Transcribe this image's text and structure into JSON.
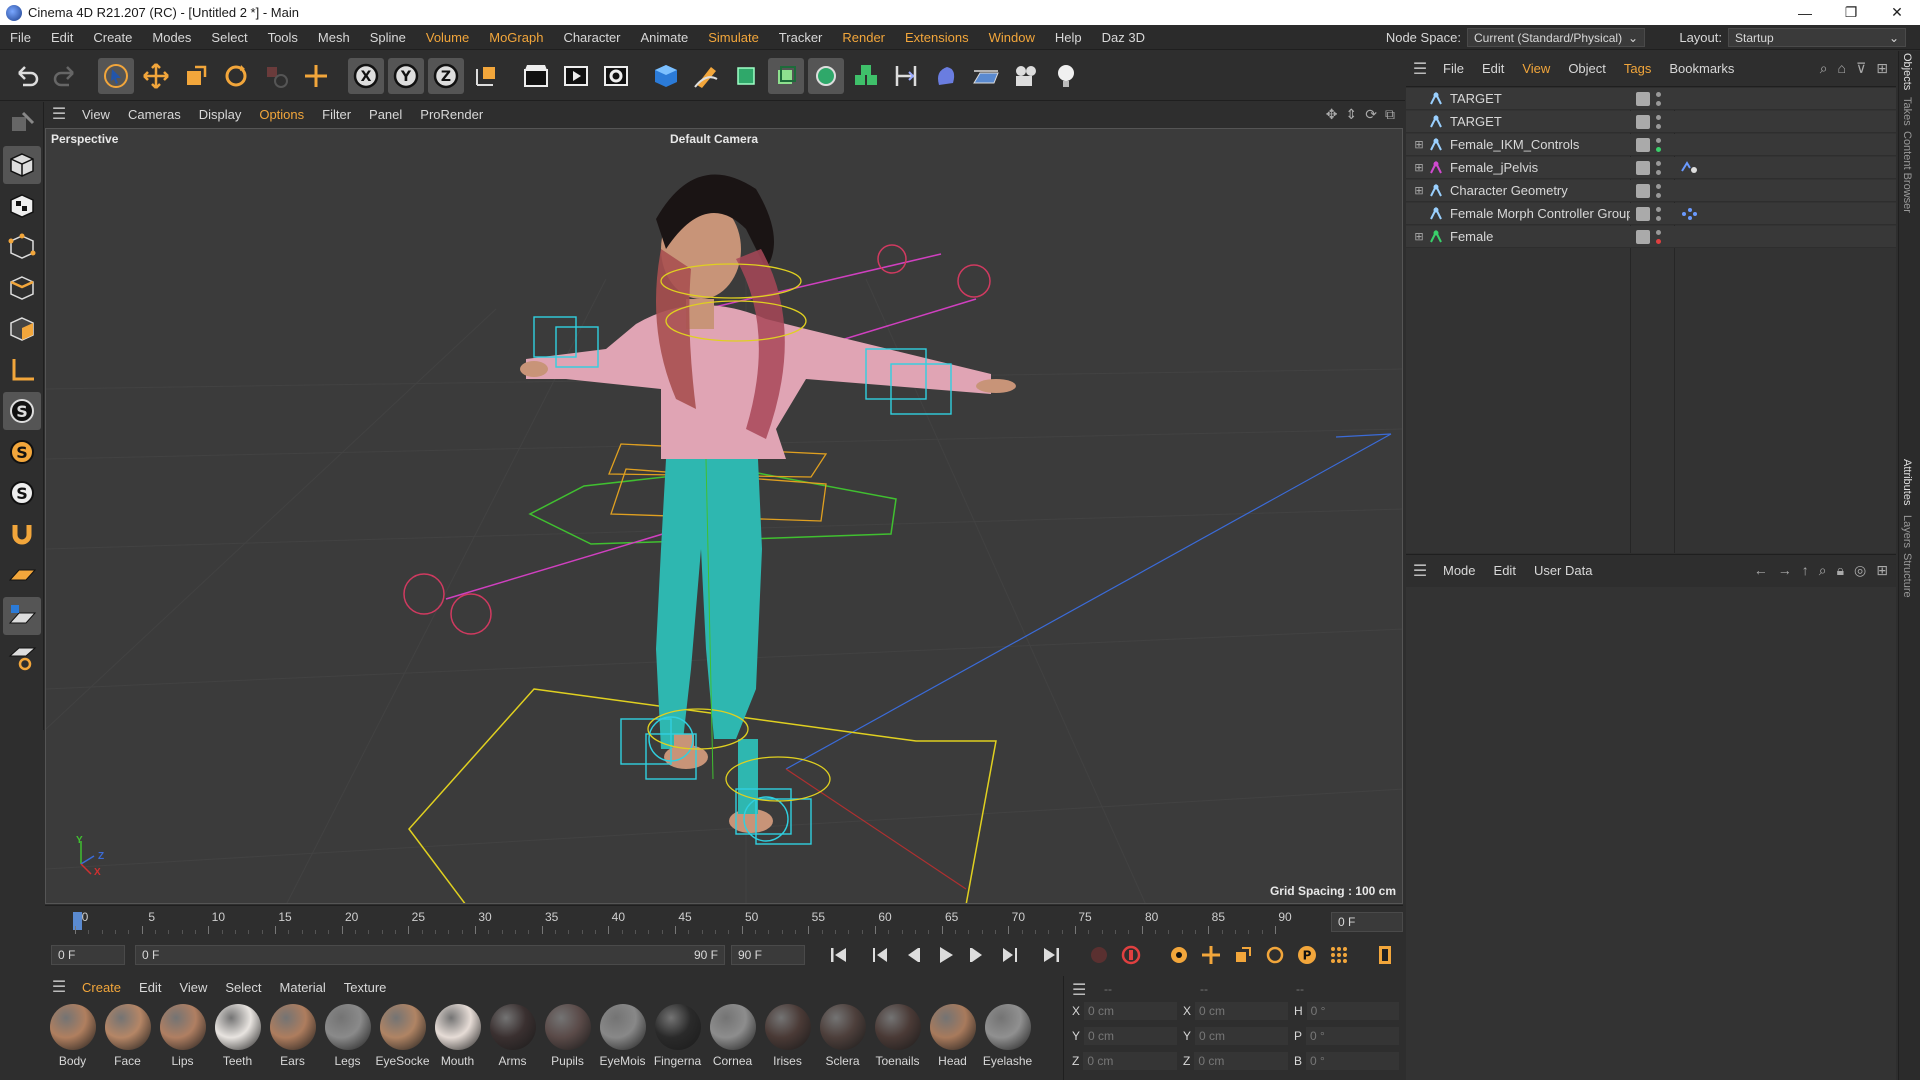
{
  "window": {
    "title": "Cinema 4D R21.207 (RC) - [Untitled 2 *] - Main",
    "minimize": "—",
    "maximize": "❐",
    "close": "✕"
  },
  "menubar": {
    "items": [
      "File",
      "Edit",
      "Create",
      "Modes",
      "Select",
      "Tools",
      "Mesh",
      "Spline",
      "Volume",
      "MoGraph",
      "Character",
      "Animate",
      "Simulate",
      "Tracker",
      "Render",
      "Extensions",
      "Window",
      "Help",
      "Daz 3D"
    ],
    "node_space_label": "Node Space:",
    "node_space_value": "Current (Standard/Physical)",
    "layout_label": "Layout:",
    "layout_value": "Startup"
  },
  "viewport": {
    "menu": [
      "View",
      "Cameras",
      "Display",
      "Options",
      "Filter",
      "Panel",
      "ProRender"
    ],
    "view_name": "Perspective",
    "camera_name": "Default Camera",
    "grid_spacing": "Grid Spacing : 100 cm",
    "axis_labels": {
      "y": "Y",
      "z": "Z",
      "x": "X"
    }
  },
  "timeline": {
    "ticks": [
      "0",
      "5",
      "10",
      "15",
      "20",
      "25",
      "30",
      "35",
      "40",
      "45",
      "50",
      "55",
      "60",
      "65",
      "70",
      "75",
      "80",
      "85",
      "90"
    ],
    "current_frame": "0 F",
    "start_field": "0 F",
    "range_start": "0 F",
    "range_end": "90 F",
    "end_field": "90 F"
  },
  "material_manager": {
    "menu": [
      "Create",
      "Edit",
      "View",
      "Select",
      "Material",
      "Texture"
    ],
    "materials": [
      {
        "name": "Body",
        "color": "#b07f5f"
      },
      {
        "name": "Face",
        "color": "#b58666"
      },
      {
        "name": "Lips",
        "color": "#b07f62"
      },
      {
        "name": "Teeth",
        "color": "#e8e4e0"
      },
      {
        "name": "Ears",
        "color": "#ae7d5e"
      },
      {
        "name": "Legs",
        "color": "#8a8a8a"
      },
      {
        "name": "EyeSocke",
        "color": "#b08464"
      },
      {
        "name": "Mouth",
        "color": "#e6dcd6"
      },
      {
        "name": "Arms",
        "color": "#3a3030"
      },
      {
        "name": "Pupils",
        "color": "#5a4a48"
      },
      {
        "name": "EyeMois",
        "color": "#888888"
      },
      {
        "name": "Fingerna",
        "color": "#2a2a2a"
      },
      {
        "name": "Cornea",
        "color": "#8d8d8d"
      },
      {
        "name": "Irises",
        "color": "#4a3a36"
      },
      {
        "name": "Sclera",
        "color": "#4d3f3b"
      },
      {
        "name": "Toenails",
        "color": "#4a3a36"
      },
      {
        "name": "Head",
        "color": "#a87a5c"
      },
      {
        "name": "Eyelashe",
        "color": "#909090"
      }
    ]
  },
  "coordinates": {
    "header": [
      "--",
      "--",
      "--"
    ],
    "rows": [
      {
        "a": "X",
        "av": "0 cm",
        "b": "X",
        "bv": "0 cm",
        "c": "H",
        "cv": "0 °"
      },
      {
        "a": "Y",
        "av": "0 cm",
        "b": "Y",
        "bv": "0 cm",
        "c": "P",
        "cv": "0 °"
      },
      {
        "a": "Z",
        "av": "0 cm",
        "b": "Z",
        "bv": "0 cm",
        "c": "B",
        "cv": "0 °"
      }
    ]
  },
  "object_manager": {
    "menu": [
      "File",
      "Edit",
      "View",
      "Object",
      "Tags",
      "Bookmarks"
    ],
    "objects": [
      {
        "name": "TARGET",
        "icon_color": "#9ad0ff",
        "dot1": "#999999",
        "dot2": "#999999",
        "expandable": false,
        "tag": ""
      },
      {
        "name": "TARGET",
        "icon_color": "#9ad0ff",
        "dot1": "#999999",
        "dot2": "#999999",
        "expandable": false,
        "tag": ""
      },
      {
        "name": "Female_IKM_Controls",
        "icon_color": "#9ad0ff",
        "dot1": "#999999",
        "dot2": "#3ad06a",
        "expandable": true,
        "tag": ""
      },
      {
        "name": "Female_jPelvis",
        "icon_color": "#d04ad0",
        "dot1": "#999999",
        "dot2": "#999999",
        "expandable": true,
        "tag": "pose"
      },
      {
        "name": "Character Geometry",
        "icon_color": "#9ad0ff",
        "dot1": "#999999",
        "dot2": "#999999",
        "expandable": true,
        "tag": ""
      },
      {
        "name": "Female Morph Controller Group",
        "icon_color": "#9ad0ff",
        "dot1": "#999999",
        "dot2": "#999999",
        "expandable": false,
        "tag": "morph"
      },
      {
        "name": "Female",
        "icon_color": "#3ad06a",
        "dot1": "#999999",
        "dot2": "#e04040",
        "expandable": true,
        "tag": ""
      }
    ]
  },
  "attribute_manager": {
    "menu": [
      "Mode",
      "Edit",
      "User Data"
    ]
  },
  "side_tabs": [
    "Objects",
    "Takes",
    "Content Browser",
    "Attributes",
    "Layers",
    "Structure"
  ],
  "colors": {
    "accent": "#f2a63b",
    "bg": "#2e2e2e",
    "viewport": "#3b3b3b"
  }
}
